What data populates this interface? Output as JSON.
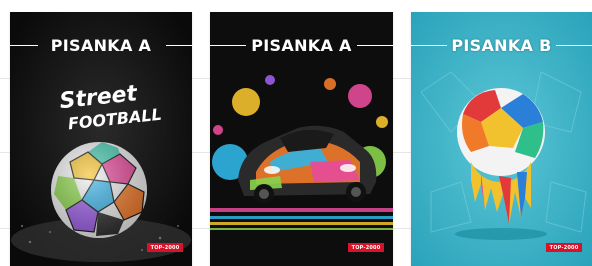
{
  "products": [
    {
      "title": "PISANKA A",
      "art_text_line1": "Street",
      "art_text_line2": "FOOTBALL",
      "theme": "street-football-ball",
      "background": "#111111",
      "logo": "TOP-2000"
    },
    {
      "title": "PISANKA A",
      "theme": "paint-splash-sports-car",
      "background": "#0d0d0d",
      "logo": "TOP-2000"
    },
    {
      "title": "PISANKA B",
      "theme": "melting-football",
      "background": "#38b3c8",
      "logo": "TOP-2000"
    }
  ]
}
